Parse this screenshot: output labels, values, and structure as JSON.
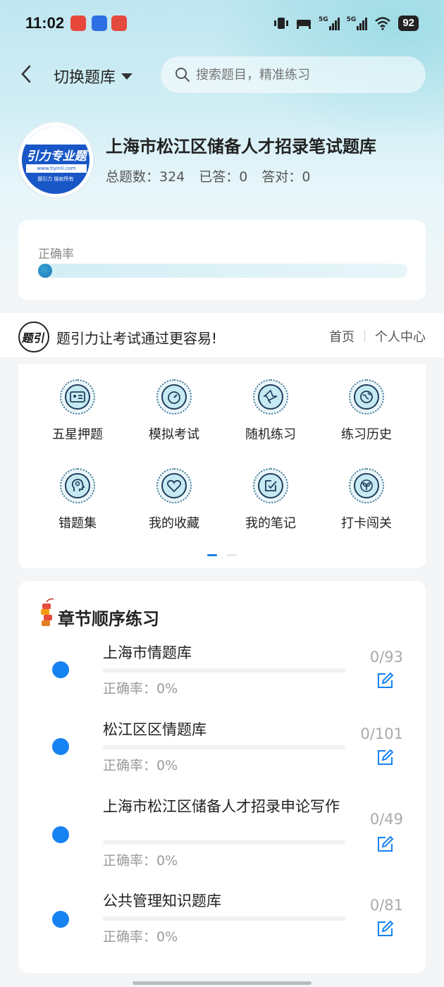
{
  "status_bar": {
    "time": "11:02",
    "network_1": "5G",
    "network_2": "5G",
    "battery": "92",
    "app_icon_colors": [
      "#e8483c",
      "#2f6fe4",
      "#e4493d"
    ]
  },
  "header": {
    "switch_label": "切换题库",
    "search_placeholder": "搜索题目，精准练习"
  },
  "bank": {
    "logo_text": "引力专业题",
    "logo_url": "www.tiyinli.com",
    "logo_footer": "题引力 版权所有",
    "title": "上海市松江区储备人才招录笔试题库",
    "total_label": "总题数：324",
    "answered_label": "已答：0",
    "correct_label": "答对：0"
  },
  "accuracy": {
    "label": "正确率",
    "value": 0
  },
  "strip": {
    "logo_text": "题引力",
    "slogan": "题引力让考试通过更容易!",
    "home_link": "首页",
    "profile_link": "个人中心"
  },
  "grid": {
    "items": [
      {
        "label": "五星押题",
        "icon": "id-card-icon"
      },
      {
        "label": "模拟考试",
        "icon": "speedometer-icon"
      },
      {
        "label": "随机练习",
        "icon": "random-star-icon"
      },
      {
        "label": "练习历史",
        "icon": "globe-history-icon"
      },
      {
        "label": "错题集",
        "icon": "head-brain-icon"
      },
      {
        "label": "我的收藏",
        "icon": "heart-icon"
      },
      {
        "label": "我的笔记",
        "icon": "note-check-icon"
      },
      {
        "label": "打卡闯关",
        "icon": "sprout-icon"
      }
    ],
    "page_count": 2,
    "active_page": 1
  },
  "chapters": {
    "title": "章节顺序练习",
    "items": [
      {
        "name": "上海市情题库",
        "accuracy": "正确率：0%",
        "count": "0/93"
      },
      {
        "name": "松江区区情题库",
        "accuracy": "正确率：0%",
        "count": "0/101"
      },
      {
        "name": "上海市松江区储备人才招录申论写作",
        "accuracy": "正确率：0%",
        "count": "0/49"
      },
      {
        "name": "公共管理知识题库",
        "accuracy": "正确率：0%",
        "count": "0/81"
      }
    ]
  }
}
